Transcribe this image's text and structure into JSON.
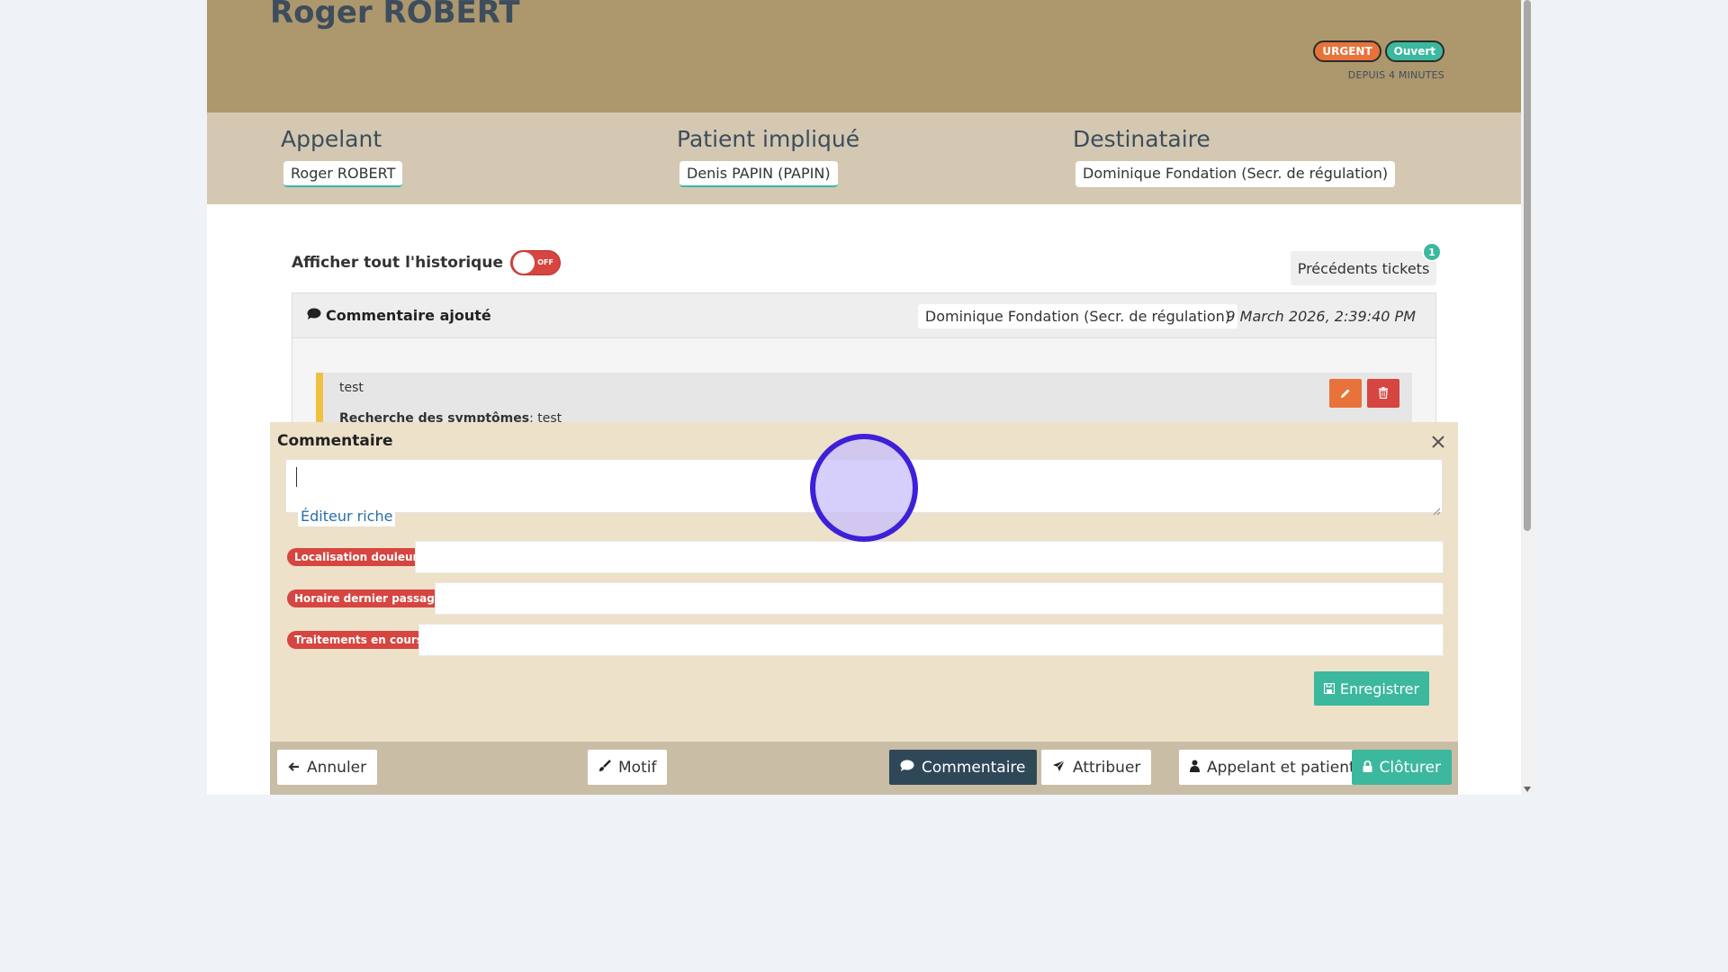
{
  "header": {
    "title": "Roger ROBERT",
    "badge_priority": "URGENT",
    "badge_status": "Ouvert",
    "since": "DEPUIS 4 MINUTES"
  },
  "parties": {
    "caller_heading": "Appelant",
    "caller_name": "Roger ROBERT",
    "patient_heading": "Patient impliqué",
    "patient_name": "Denis PAPIN (PAPIN)",
    "recipient_heading": "Destinataire",
    "recipient_name": "Dominique Fondation (Secr. de régulation)"
  },
  "history": {
    "toggle_label": "Afficher tout l'historique",
    "toggle_state": "OFF",
    "previous_tickets_label": "Précédents tickets",
    "previous_tickets_count": "1"
  },
  "entry": {
    "title": "Commentaire ajouté",
    "author": "Dominique Fondation (Secr. de régulation)",
    "date": "9 March 2026, 2:39:40 PM",
    "note_text": "test",
    "symptom_label": "Recherche des symptômes",
    "symptom_value": ": test"
  },
  "comment_panel": {
    "title": "Commentaire",
    "textarea_value": "",
    "rich_editor_label": "Éditeur riche",
    "fields": [
      {
        "label": "Localisation douleur",
        "value": ""
      },
      {
        "label": "Horaire dernier passage",
        "value": ""
      },
      {
        "label": "Traitements en cours",
        "value": ""
      }
    ],
    "save_label": "Enregistrer"
  },
  "bottom_bar": {
    "cancel_label": "Annuler",
    "motif_label": "Motif",
    "comment_label": "Commentaire",
    "assign_label": "Attribuer",
    "caller_patient_label": "Appelant et patient(s)",
    "close_label": "Clôturer"
  },
  "colors": {
    "header_bg": "#ad976d",
    "parties_bg": "#d4c8b2",
    "accent_green": "#3cb89e",
    "urgent_orange": "#e8733a",
    "danger_red": "#d64540",
    "panel_bg": "#ede1c9",
    "active_tab": "#2f4858"
  }
}
